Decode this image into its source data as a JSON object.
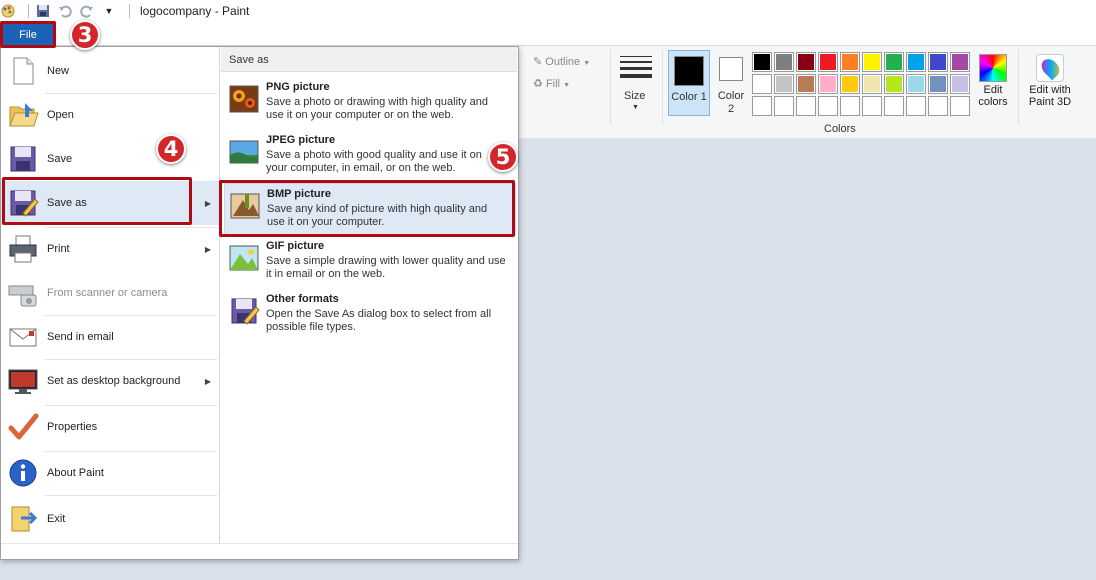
{
  "window": {
    "title": "logocompany - Paint"
  },
  "ribbon": {
    "file_label": "File",
    "outline_label": "Outline",
    "fill_label": "Fill",
    "size_label": "Size",
    "color1_label": "Color 1",
    "color2_label": "Color 2",
    "colors_group_label": "Colors",
    "edit_colors_label": "Edit colors",
    "edit_paint3d_label": "Edit with Paint 3D",
    "palette": [
      "#000000",
      "#7f7f7f",
      "#880015",
      "#ed1c24",
      "#ff7f27",
      "#fff200",
      "#22b14c",
      "#00a2e8",
      "#3f48cc",
      "#a349a4",
      "#ffffff",
      "#c3c3c3",
      "#b97a57",
      "#ffaec9",
      "#ffc90e",
      "#efe4b0",
      "#b5e61d",
      "#99d9ea",
      "#7092be",
      "#c8bfe7",
      "#ffffff",
      "#ffffff",
      "#ffffff",
      "#ffffff",
      "#ffffff",
      "#ffffff",
      "#ffffff",
      "#ffffff",
      "#ffffff",
      "#ffffff"
    ]
  },
  "file_menu": {
    "items": [
      {
        "label": "New"
      },
      {
        "label": "Open"
      },
      {
        "label": "Save"
      },
      {
        "label": "Save as"
      },
      {
        "label": "Print"
      },
      {
        "label": "From scanner or camera"
      },
      {
        "label": "Send in email"
      },
      {
        "label": "Set as desktop background"
      },
      {
        "label": "Properties"
      },
      {
        "label": "About Paint"
      },
      {
        "label": "Exit"
      }
    ],
    "save_as": {
      "header": "Save as",
      "options": [
        {
          "title": "PNG picture",
          "desc": "Save a photo or drawing with high quality and use it on your computer or on the web."
        },
        {
          "title": "JPEG picture",
          "desc": "Save a photo with good quality and use it on your computer, in email, or on the web."
        },
        {
          "title": "BMP picture",
          "desc": "Save any kind of picture with high quality and use it on your computer."
        },
        {
          "title": "GIF picture",
          "desc": "Save a simple drawing with lower quality and use it in email or on the web."
        },
        {
          "title": "Other formats",
          "desc": "Open the Save As dialog box to select from all possible file types."
        }
      ]
    }
  },
  "annotations": {
    "step3": "3",
    "step4": "4",
    "step5": "5"
  },
  "colors": {
    "highlight": "#b00a12",
    "step_badge": "#d3262b",
    "file_button": "#1c63b7",
    "accent": "#1c63b7"
  }
}
